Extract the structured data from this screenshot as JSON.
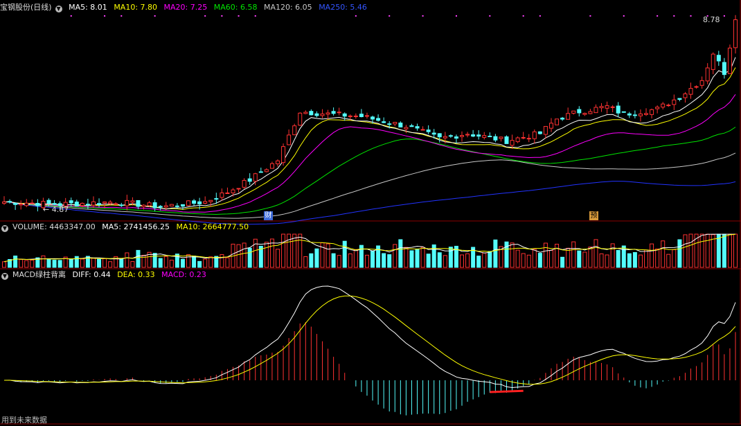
{
  "colors": {
    "up": "#ff3232",
    "down": "#54fcfc",
    "ma5": "#ffffff",
    "ma10": "#ffff00",
    "ma20": "#ff00ff",
    "ma60": "#00e600",
    "ma120": "#c8c8c8",
    "ma250": "#2233ff",
    "diff": "#ffffff",
    "dea": "#ffff00",
    "macd": "#ff00ff",
    "panel_border": "#8b0000"
  },
  "main_legend": {
    "title": "宝钢股份(日线)",
    "ma5": "MA5: 8.01",
    "ma10": "MA10: 7.80",
    "ma20": "MA20: 7.25",
    "ma60": "MA60: 6.58",
    "ma120": "MA120: 6.05",
    "ma250": "MA250: 5.46"
  },
  "volume_legend": {
    "volume": "VOLUME: 4463347.00",
    "ma5": "MA5: 2741456.25",
    "ma10": "MA10: 2664777.50"
  },
  "macd_legend": {
    "name": "MACD绿柱背离",
    "diff": "DIFF: 0.44",
    "dea": "DEA: 0.33",
    "macd": "MACD: 0.23"
  },
  "labels": {
    "price_max": "8.78",
    "price_min": "4.87",
    "marker_cai": "财",
    "marker_yu": "预",
    "footer": "用到未来数据"
  },
  "chart_data": {
    "type": "candlestick",
    "series_count": 132,
    "price_range": [
      4.7,
      8.9
    ],
    "max_close": 8.78,
    "min_low": 4.87,
    "price_anchors": [
      [
        0,
        5.05
      ],
      [
        10,
        5.0
      ],
      [
        20,
        5.05
      ],
      [
        28,
        4.95
      ],
      [
        36,
        5.05
      ],
      [
        40,
        5.25
      ],
      [
        44,
        5.5
      ],
      [
        49,
        5.9
      ],
      [
        53,
        6.9
      ],
      [
        58,
        6.85
      ],
      [
        64,
        6.8
      ],
      [
        68,
        6.7
      ],
      [
        72,
        6.6
      ],
      [
        78,
        6.35
      ],
      [
        83,
        6.45
      ],
      [
        90,
        6.3
      ],
      [
        96,
        6.45
      ],
      [
        99,
        6.75
      ],
      [
        103,
        6.9
      ],
      [
        108,
        7.0
      ],
      [
        111,
        6.85
      ],
      [
        117,
        6.95
      ],
      [
        121,
        7.2
      ],
      [
        125,
        7.55
      ],
      [
        127,
        8.1
      ],
      [
        129,
        7.7
      ],
      [
        131,
        8.78
      ]
    ],
    "ma_last": {
      "ma5": 8.01,
      "ma10": 7.8,
      "ma20": 7.25,
      "ma60": 6.58,
      "ma120": 6.05,
      "ma250": 5.46
    },
    "volume": {
      "last": 4463347.0,
      "ma5": 2741456.25,
      "ma10": 2664777.5
    },
    "macd": {
      "diff": 0.44,
      "dea": 0.33,
      "macd": 0.23
    }
  }
}
